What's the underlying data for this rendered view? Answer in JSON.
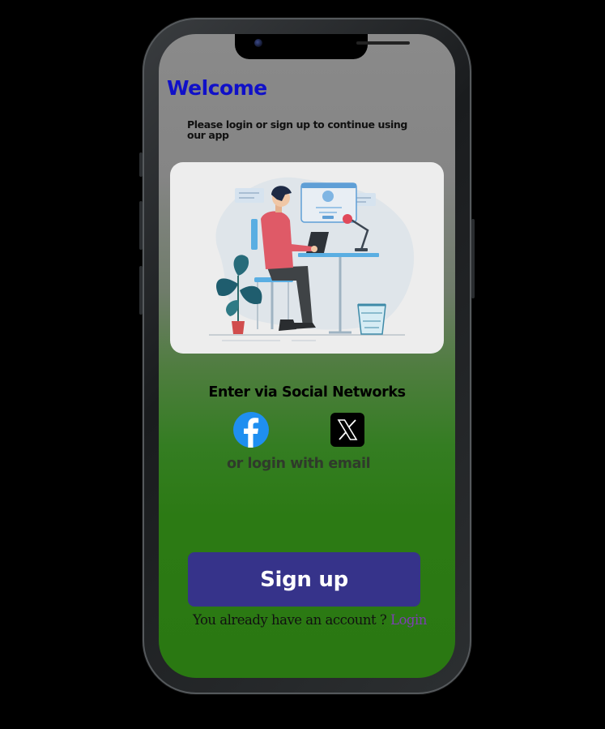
{
  "welcome": {
    "title": "Welcome",
    "subtitle": "Please login or sign up to continue using our app"
  },
  "social": {
    "title": "Enter via Social Networks",
    "facebook_icon": "facebook-icon",
    "x_icon": "x-twitter-icon",
    "or_email": "or login with email"
  },
  "actions": {
    "signup_label": "Sign up",
    "account_prompt": "You already have an account ?",
    "login_label": "Login"
  },
  "colors": {
    "welcome": "#1010c8",
    "signup_button": "#36338a",
    "login_link": "#7d3fb2",
    "facebook": "#1f8ff0",
    "background_bottom": "#2a7812"
  }
}
